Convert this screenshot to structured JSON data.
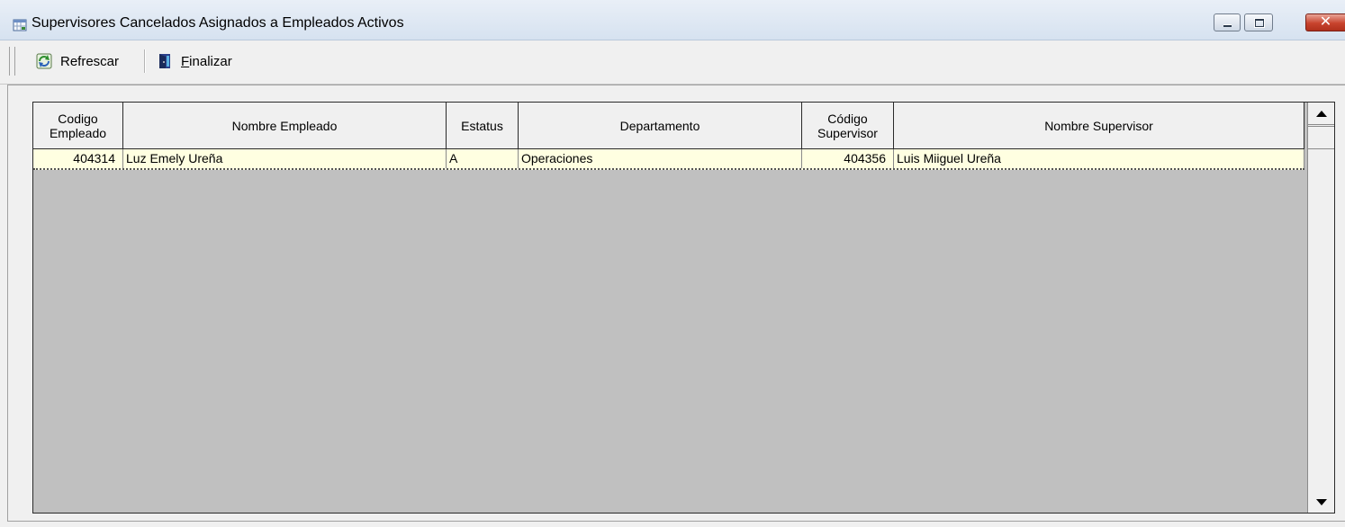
{
  "window": {
    "title": "Supervisores Cancelados Asignados a Empleados Activos",
    "app_icon": "calendar-grid-icon",
    "controls": [
      "minimize-icon",
      "restore-icon",
      "close-icon"
    ]
  },
  "toolbar": {
    "refresh_label": "Refrescar",
    "refresh_icon": "refresh-icon",
    "finish_mnemonic": "F",
    "finish_rest": "inalizar",
    "finish_icon": "exit-door-icon"
  },
  "grid": {
    "columns": [
      "Codigo\nEmpleado",
      "Nombre Empleado",
      "Estatus",
      "Departamento",
      "Código\nSupervisor",
      "Nombre Supervisor"
    ],
    "rows": [
      [
        "404314",
        "Luz Emely Ureña",
        "A",
        "Operaciones",
        "404356",
        "Luis Miiguel Ureña"
      ]
    ],
    "colors": {
      "row_background": "#ffffe1",
      "empty_area": "#c0c0c0",
      "header_background": "#f0f0f0"
    }
  }
}
